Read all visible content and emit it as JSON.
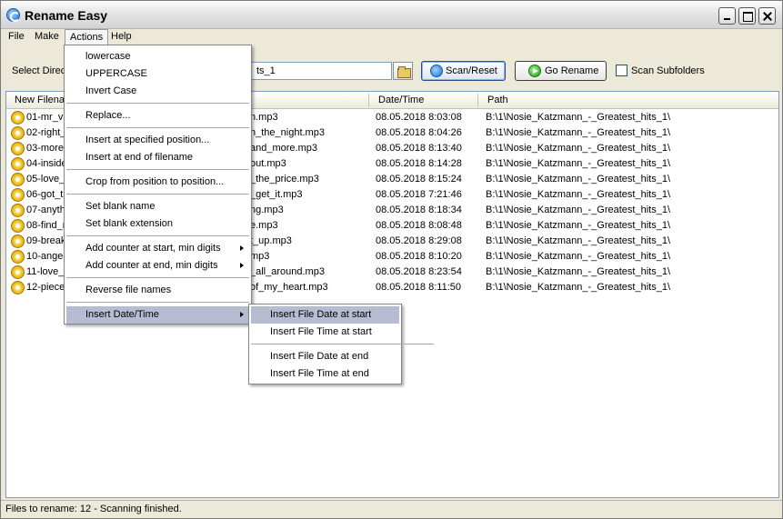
{
  "window": {
    "title": "Rename Easy"
  },
  "menu_bar": [
    {
      "label": "File"
    },
    {
      "label": "Make"
    },
    {
      "label": "Actions"
    },
    {
      "label": "Help"
    }
  ],
  "toolbar": {
    "select_label": "Select Direc",
    "directory_value": "ts_1",
    "scan_reset": "Scan/Reset",
    "go_rename": "Go Rename",
    "scan_subfolders": "Scan Subfolders",
    "scan_subfolders_checked": false
  },
  "list": {
    "columns": [
      "New Filena",
      "Date/Time",
      "Path"
    ],
    "rows": [
      {
        "new_name": "01-mr_va",
        "old_name": "n.mp3",
        "datetime": "08.05.2018 8:03:08",
        "path": "B:\\1\\Nosie_Katzmann_-_Greatest_hits_1\\"
      },
      {
        "new_name": "02-right_",
        "old_name": "n_the_night.mp3",
        "datetime": "08.05.2018 8:04:26",
        "path": "B:\\1\\Nosie_Katzmann_-_Greatest_hits_1\\"
      },
      {
        "new_name": "03-more_",
        "old_name": "and_more.mp3",
        "datetime": "08.05.2018 8:13:40",
        "path": "B:\\1\\Nosie_Katzmann_-_Greatest_hits_1\\"
      },
      {
        "new_name": "04-inside",
        "old_name": "out.mp3",
        "datetime": "08.05.2018 8:14:28",
        "path": "B:\\1\\Nosie_Katzmann_-_Greatest_hits_1\\"
      },
      {
        "new_name": "05-love_",
        "old_name": "_the_price.mp3",
        "datetime": "08.05.2018 8:15:24",
        "path": "B:\\1\\Nosie_Katzmann_-_Greatest_hits_1\\"
      },
      {
        "new_name": "06-got_t",
        "old_name": "_get_it.mp3",
        "datetime": "08.05.2018 7:21:46",
        "path": "B:\\1\\Nosie_Katzmann_-_Greatest_hits_1\\"
      },
      {
        "new_name": "07-anyth",
        "old_name": "ng.mp3",
        "datetime": "08.05.2018 8:18:34",
        "path": "B:\\1\\Nosie_Katzmann_-_Greatest_hits_1\\"
      },
      {
        "new_name": "08-find_r",
        "old_name": "e.mp3",
        "datetime": "08.05.2018 8:08:48",
        "path": "B:\\1\\Nosie_Katzmann_-_Greatest_hits_1\\"
      },
      {
        "new_name": "09-break",
        "old_name": "t_up.mp3",
        "datetime": "08.05.2018 8:29:08",
        "path": "B:\\1\\Nosie_Katzmann_-_Greatest_hits_1\\"
      },
      {
        "new_name": "10-angel",
        "old_name": "mp3",
        "datetime": "08.05.2018 8:10:20",
        "path": "B:\\1\\Nosie_Katzmann_-_Greatest_hits_1\\"
      },
      {
        "new_name": "11-love_",
        "old_name": "_all_around.mp3",
        "datetime": "08.05.2018 8:23:54",
        "path": "B:\\1\\Nosie_Katzmann_-_Greatest_hits_1\\"
      },
      {
        "new_name": "12-piece",
        "old_name": "of_my_heart.mp3",
        "datetime": "08.05.2018 8:11:50",
        "path": "B:\\1\\Nosie_Katzmann_-_Greatest_hits_1\\"
      }
    ]
  },
  "actions_menu": [
    {
      "label": "lowercase"
    },
    {
      "label": "UPPERCASE"
    },
    {
      "label": "Invert Case"
    },
    {
      "label": "Replace..."
    },
    {
      "label": "Insert at specified position..."
    },
    {
      "label": "Insert at end of filename"
    },
    {
      "label": "Crop from position to position..."
    },
    {
      "label": "Set blank name"
    },
    {
      "label": "Set blank extension"
    },
    {
      "label": "Add counter at start, min digits"
    },
    {
      "label": "Add counter at end, min digits"
    },
    {
      "label": "Reverse file names"
    },
    {
      "label": "Insert Date/Time"
    }
  ],
  "date_submenu": [
    {
      "label": "Insert File Date at start"
    },
    {
      "label": "Insert File Time at start"
    },
    {
      "label": "Insert File Date at end"
    },
    {
      "label": "Insert File Time at end"
    }
  ],
  "status": {
    "text": "Files to rename: 12 - Scanning finished."
  }
}
